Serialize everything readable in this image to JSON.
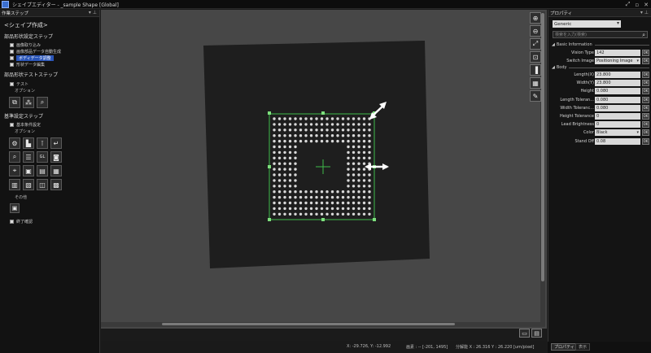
{
  "window": {
    "title": "シェイプエディター - _sample Shape [Global]",
    "controls": [
      "⤢",
      "▫",
      "✕"
    ]
  },
  "left_panel": {
    "header": "作業ステップ",
    "title": "<シェイプ作成>",
    "sections": [
      {
        "title": "部品形状設定ステップ",
        "items": [
          {
            "label": "画像取り込み",
            "selected": false
          },
          {
            "label": "画像部品データ自動生成",
            "selected": false
          },
          {
            "label": "ボディデータ調整",
            "selected": true
          },
          {
            "label": "形状データ編集",
            "selected": false
          }
        ]
      },
      {
        "title": "部品形状テストステップ",
        "items": [
          {
            "label": "テスト",
            "selected": false
          }
        ],
        "sub": "オプション"
      },
      {
        "title": "基準設定ステップ",
        "items": [
          {
            "label": "基本条件設定",
            "selected": false
          }
        ],
        "sub": "オプション"
      }
    ],
    "other_label": "その他",
    "end_label": "終了確認"
  },
  "right_panel": {
    "header": "プロパティ",
    "category": "Generic",
    "search_placeholder": "検索を入力(検索)",
    "groups": {
      "basic": "Basic Information",
      "body": "Body"
    },
    "basic_props": [
      {
        "label": "Vision Type",
        "value": "142",
        "dropdown": false
      },
      {
        "label": "Switch Image",
        "value": "Positioning Image",
        "dropdown": true
      }
    ],
    "body_props": [
      {
        "label": "Length(X)",
        "value": "23.800",
        "dropdown": false
      },
      {
        "label": "Width(Y)",
        "value": "23.800",
        "dropdown": false
      },
      {
        "label": "Height",
        "value": "0.080",
        "dropdown": false
      },
      {
        "label": "Length Toleran...",
        "value": "0.080",
        "dropdown": false
      },
      {
        "label": "Width Toleranc...",
        "value": "0.080",
        "dropdown": false
      },
      {
        "label": "Height Tolerance",
        "value": "0",
        "dropdown": false
      },
      {
        "label": "Lead Brightness",
        "value": "0",
        "dropdown": false
      },
      {
        "label": "Color",
        "value": "Black",
        "dropdown": true
      },
      {
        "label": "Stand Off",
        "value": "0.08",
        "dropdown": false
      }
    ],
    "ok_label": "OK",
    "tab_active": "プロパティ",
    "tab_other": "表示"
  },
  "status": {
    "coords": "X: -29.726, Y: -12.992",
    "range": "画素 : -- [-201, 1495]",
    "resolution": "分解能 X : 26.316   Y : 26.220 [um/pixel]"
  },
  "icons": {
    "left_tools": [
      "zoom-to-image-icon",
      "grid-detect-icon",
      "zoom-select-icon"
    ],
    "condition_tools": [
      "settings-icon",
      "lead-icon",
      "pin-icon",
      "arrow-icon",
      "search-icon",
      "bar-icon",
      "gl-icon",
      "chip-icon",
      "magnify-icon",
      "camera-icon",
      "list-icon",
      "grid-icon",
      "component-icon",
      "table-icon",
      "package-icon",
      "window-icon"
    ],
    "canvas_tools": [
      "zoom-in-icon",
      "zoom-out-icon",
      "fit-icon",
      "zoom-box-icon",
      "panel-icon",
      "settings-icon",
      "edit-icon"
    ]
  }
}
